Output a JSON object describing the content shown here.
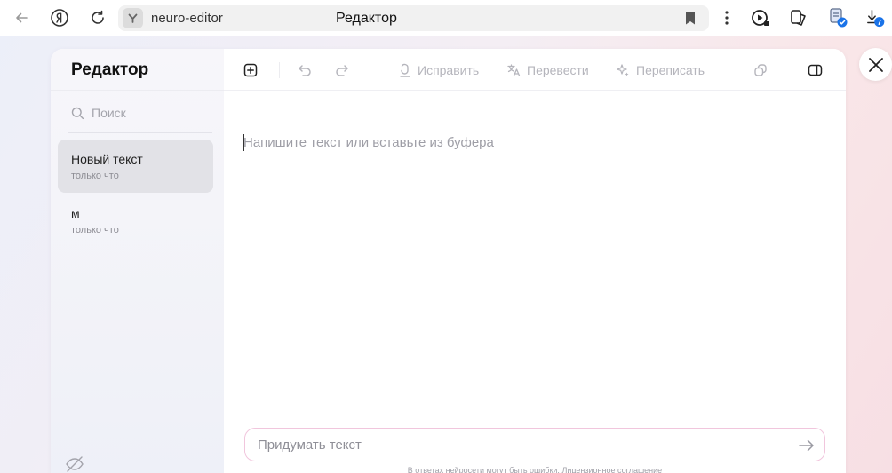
{
  "browser": {
    "url": "neuro-editor",
    "page_title": "Редактор",
    "downloads_badge": "7"
  },
  "sidebar": {
    "title": "Редактор",
    "search_placeholder": "Поиск",
    "docs": [
      {
        "name": "Новый текст",
        "time": "только что",
        "active": true
      },
      {
        "name": "м",
        "time": "только что",
        "active": false
      }
    ]
  },
  "toolbar": {
    "fix_label": "Исправить",
    "translate_label": "Перевести",
    "rewrite_label": "Переписать"
  },
  "editor": {
    "placeholder": "Напишите текст или вставьте из буфера"
  },
  "prompt": {
    "placeholder": "Придумать текст"
  },
  "footer": {
    "disclaimer": "В ответах нейросети могут быть ошибки.",
    "license_link": "Лицензионное соглашение"
  },
  "colors": {
    "accent_pink": "#f1c6dd",
    "badge_blue": "#1a73e8"
  }
}
